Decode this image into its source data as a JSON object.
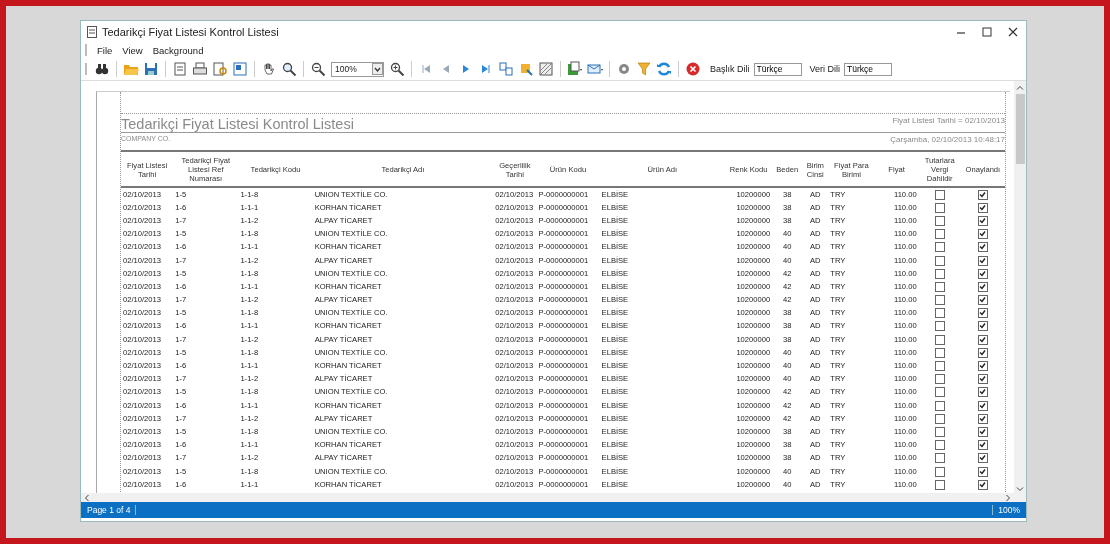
{
  "window": {
    "title": "Tedarikçi Fiyat Listesi Kontrol Listesi"
  },
  "menu": [
    {
      "label": "File"
    },
    {
      "label": "View"
    },
    {
      "label": "Background"
    }
  ],
  "toolbar": {
    "zoom": "100%",
    "header_language": {
      "label": "Başlık Dili",
      "value": "Türkçe"
    },
    "data_language": {
      "label": "Veri Dili",
      "value": "Türkçe"
    }
  },
  "report": {
    "title": "Tedarikçi Fiyat Listesi Kontrol Listesi",
    "filter": "Fiyat Listesi Tarihi = 02/10/2013",
    "company": "COMPANY CO.",
    "timestamp": "Çarşamba, 02/10/2013 10:48:17",
    "columns": [
      "Fiyat Listesi Tarihi",
      "Tedarikçi Fiyat Listesi Ref Numarası",
      "Tedarikçi Kodu",
      "Tedarikçi Adı",
      "Geçerlilik Tarihi",
      "Ürün Kodu",
      "Ürün Adı",
      "Renk Kodu",
      "Beden",
      "Birim Cinsi",
      "Fiyat Para Birimi",
      "Fiyat",
      "Tutarlara Vergi Dahildir",
      "Onaylandı"
    ],
    "rows": [
      {
        "date": "02/10/2013",
        "ref": "1-5",
        "supplier_code": "1-1-8",
        "supplier": "UNION TEXTİLE CO.",
        "valid": "02/10/2013",
        "product_code": "P-0000000001",
        "product": "ELBİSE",
        "color_code": "10200000",
        "size": "38",
        "unit": "AD",
        "currency": "TRY",
        "price": "110.00",
        "tax_included": false,
        "approved": true
      },
      {
        "date": "02/10/2013",
        "ref": "1-6",
        "supplier_code": "1-1-1",
        "supplier": "KORHAN TİCARET",
        "valid": "02/10/2013",
        "product_code": "P-0000000001",
        "product": "ELBİSE",
        "color_code": "10200000",
        "size": "38",
        "unit": "AD",
        "currency": "TRY",
        "price": "110.00",
        "tax_included": false,
        "approved": true
      },
      {
        "date": "02/10/2013",
        "ref": "1-7",
        "supplier_code": "1-1-2",
        "supplier": "ALPAY TİCARET",
        "valid": "02/10/2013",
        "product_code": "P-0000000001",
        "product": "ELBİSE",
        "color_code": "10200000",
        "size": "38",
        "unit": "AD",
        "currency": "TRY",
        "price": "110.00",
        "tax_included": false,
        "approved": true
      },
      {
        "date": "02/10/2013",
        "ref": "1-5",
        "supplier_code": "1-1-8",
        "supplier": "UNION TEXTİLE CO.",
        "valid": "02/10/2013",
        "product_code": "P-0000000001",
        "product": "ELBİSE",
        "color_code": "10200000",
        "size": "40",
        "unit": "AD",
        "currency": "TRY",
        "price": "110.00",
        "tax_included": false,
        "approved": true
      },
      {
        "date": "02/10/2013",
        "ref": "1-6",
        "supplier_code": "1-1-1",
        "supplier": "KORHAN TİCARET",
        "valid": "02/10/2013",
        "product_code": "P-0000000001",
        "product": "ELBİSE",
        "color_code": "10200000",
        "size": "40",
        "unit": "AD",
        "currency": "TRY",
        "price": "110.00",
        "tax_included": false,
        "approved": true
      },
      {
        "date": "02/10/2013",
        "ref": "1-7",
        "supplier_code": "1-1-2",
        "supplier": "ALPAY TİCARET",
        "valid": "02/10/2013",
        "product_code": "P-0000000001",
        "product": "ELBİSE",
        "color_code": "10200000",
        "size": "40",
        "unit": "AD",
        "currency": "TRY",
        "price": "110.00",
        "tax_included": false,
        "approved": true
      },
      {
        "date": "02/10/2013",
        "ref": "1-5",
        "supplier_code": "1-1-8",
        "supplier": "UNION TEXTİLE CO.",
        "valid": "02/10/2013",
        "product_code": "P-0000000001",
        "product": "ELBİSE",
        "color_code": "10200000",
        "size": "42",
        "unit": "AD",
        "currency": "TRY",
        "price": "110.00",
        "tax_included": false,
        "approved": true
      },
      {
        "date": "02/10/2013",
        "ref": "1-6",
        "supplier_code": "1-1-1",
        "supplier": "KORHAN TİCARET",
        "valid": "02/10/2013",
        "product_code": "P-0000000001",
        "product": "ELBİSE",
        "color_code": "10200000",
        "size": "42",
        "unit": "AD",
        "currency": "TRY",
        "price": "110.00",
        "tax_included": false,
        "approved": true
      },
      {
        "date": "02/10/2013",
        "ref": "1-7",
        "supplier_code": "1-1-2",
        "supplier": "ALPAY TİCARET",
        "valid": "02/10/2013",
        "product_code": "P-0000000001",
        "product": "ELBİSE",
        "color_code": "10200000",
        "size": "42",
        "unit": "AD",
        "currency": "TRY",
        "price": "110.00",
        "tax_included": false,
        "approved": true
      },
      {
        "date": "02/10/2013",
        "ref": "1-5",
        "supplier_code": "1-1-8",
        "supplier": "UNION TEXTİLE CO.",
        "valid": "02/10/2013",
        "product_code": "P-0000000001",
        "product": "ELBİSE",
        "color_code": "10200000",
        "size": "38",
        "unit": "AD",
        "currency": "TRY",
        "price": "110.00",
        "tax_included": false,
        "approved": true
      },
      {
        "date": "02/10/2013",
        "ref": "1-6",
        "supplier_code": "1-1-1",
        "supplier": "KORHAN TİCARET",
        "valid": "02/10/2013",
        "product_code": "P-0000000001",
        "product": "ELBİSE",
        "color_code": "10200000",
        "size": "38",
        "unit": "AD",
        "currency": "TRY",
        "price": "110.00",
        "tax_included": false,
        "approved": true
      },
      {
        "date": "02/10/2013",
        "ref": "1-7",
        "supplier_code": "1-1-2",
        "supplier": "ALPAY TİCARET",
        "valid": "02/10/2013",
        "product_code": "P-0000000001",
        "product": "ELBİSE",
        "color_code": "10200000",
        "size": "38",
        "unit": "AD",
        "currency": "TRY",
        "price": "110.00",
        "tax_included": false,
        "approved": true
      },
      {
        "date": "02/10/2013",
        "ref": "1-5",
        "supplier_code": "1-1-8",
        "supplier": "UNION TEXTİLE CO.",
        "valid": "02/10/2013",
        "product_code": "P-0000000001",
        "product": "ELBİSE",
        "color_code": "10200000",
        "size": "40",
        "unit": "AD",
        "currency": "TRY",
        "price": "110.00",
        "tax_included": false,
        "approved": true
      },
      {
        "date": "02/10/2013",
        "ref": "1-6",
        "supplier_code": "1-1-1",
        "supplier": "KORHAN TİCARET",
        "valid": "02/10/2013",
        "product_code": "P-0000000001",
        "product": "ELBİSE",
        "color_code": "10200000",
        "size": "40",
        "unit": "AD",
        "currency": "TRY",
        "price": "110.00",
        "tax_included": false,
        "approved": true
      },
      {
        "date": "02/10/2013",
        "ref": "1-7",
        "supplier_code": "1-1-2",
        "supplier": "ALPAY TİCARET",
        "valid": "02/10/2013",
        "product_code": "P-0000000001",
        "product": "ELBİSE",
        "color_code": "10200000",
        "size": "40",
        "unit": "AD",
        "currency": "TRY",
        "price": "110.00",
        "tax_included": false,
        "approved": true
      },
      {
        "date": "02/10/2013",
        "ref": "1-5",
        "supplier_code": "1-1-8",
        "supplier": "UNION TEXTİLE CO.",
        "valid": "02/10/2013",
        "product_code": "P-0000000001",
        "product": "ELBİSE",
        "color_code": "10200000",
        "size": "42",
        "unit": "AD",
        "currency": "TRY",
        "price": "110.00",
        "tax_included": false,
        "approved": true
      },
      {
        "date": "02/10/2013",
        "ref": "1-6",
        "supplier_code": "1-1-1",
        "supplier": "KORHAN TİCARET",
        "valid": "02/10/2013",
        "product_code": "P-0000000001",
        "product": "ELBİSE",
        "color_code": "10200000",
        "size": "42",
        "unit": "AD",
        "currency": "TRY",
        "price": "110.00",
        "tax_included": false,
        "approved": true
      },
      {
        "date": "02/10/2013",
        "ref": "1-7",
        "supplier_code": "1-1-2",
        "supplier": "ALPAY TİCARET",
        "valid": "02/10/2013",
        "product_code": "P-0000000001",
        "product": "ELBİSE",
        "color_code": "10200000",
        "size": "42",
        "unit": "AD",
        "currency": "TRY",
        "price": "110.00",
        "tax_included": false,
        "approved": true
      },
      {
        "date": "02/10/2013",
        "ref": "1-5",
        "supplier_code": "1-1-8",
        "supplier": "UNION TEXTİLE CO.",
        "valid": "02/10/2013",
        "product_code": "P-0000000001",
        "product": "ELBİSE",
        "color_code": "10200000",
        "size": "38",
        "unit": "AD",
        "currency": "TRY",
        "price": "110.00",
        "tax_included": false,
        "approved": true
      },
      {
        "date": "02/10/2013",
        "ref": "1-6",
        "supplier_code": "1-1-1",
        "supplier": "KORHAN TİCARET",
        "valid": "02/10/2013",
        "product_code": "P-0000000001",
        "product": "ELBİSE",
        "color_code": "10200000",
        "size": "38",
        "unit": "AD",
        "currency": "TRY",
        "price": "110.00",
        "tax_included": false,
        "approved": true
      },
      {
        "date": "02/10/2013",
        "ref": "1-7",
        "supplier_code": "1-1-2",
        "supplier": "ALPAY TİCARET",
        "valid": "02/10/2013",
        "product_code": "P-0000000001",
        "product": "ELBİSE",
        "color_code": "10200000",
        "size": "38",
        "unit": "AD",
        "currency": "TRY",
        "price": "110.00",
        "tax_included": false,
        "approved": true
      },
      {
        "date": "02/10/2013",
        "ref": "1-5",
        "supplier_code": "1-1-8",
        "supplier": "UNION TEXTİLE CO.",
        "valid": "02/10/2013",
        "product_code": "P-0000000001",
        "product": "ELBİSE",
        "color_code": "10200000",
        "size": "40",
        "unit": "AD",
        "currency": "TRY",
        "price": "110.00",
        "tax_included": false,
        "approved": true
      },
      {
        "date": "02/10/2013",
        "ref": "1-6",
        "supplier_code": "1-1-1",
        "supplier": "KORHAN TİCARET",
        "valid": "02/10/2013",
        "product_code": "P-0000000001",
        "product": "ELBİSE",
        "color_code": "10200000",
        "size": "40",
        "unit": "AD",
        "currency": "TRY",
        "price": "110.00",
        "tax_included": false,
        "approved": true
      }
    ]
  },
  "status_bar": {
    "page": "Page 1 of 4",
    "zoom": "100%"
  }
}
